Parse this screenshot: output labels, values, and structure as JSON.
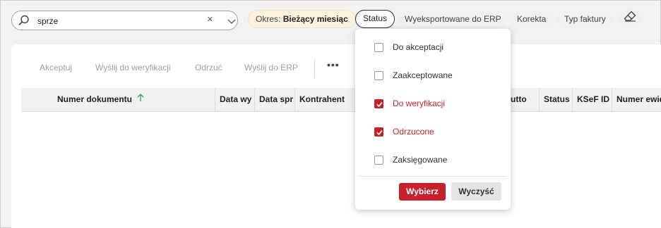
{
  "search": {
    "value": "sprze",
    "clear_glyph": "×",
    "icons": {
      "search": "search-icon",
      "clear": "close-icon",
      "dropdown": "chevron-down-icon"
    }
  },
  "filters": {
    "okres_label": "Okres:",
    "okres_value": "Bieżący miesiąc",
    "status": "Status",
    "erp": "Wyeksportowane do ERP",
    "korekta": "Korekta",
    "typ": "Typ faktury",
    "clear_icon": "eraser-icon"
  },
  "toolbar": {
    "akceptuj": "Akceptuj",
    "wyslij_weryfikacji": "Wyślij do weryfikacji",
    "odrzuc": "Odrzuć",
    "wyslij_erp": "Wyślij do ERP",
    "more": "•••"
  },
  "table": {
    "columns": [
      "Numer dokumentu",
      "Data wy",
      "Data spr",
      "Kontrahent",
      "brutto",
      "Status",
      "KSeF ID",
      "Numer ewid"
    ],
    "sort_icon": "arrow-up-icon"
  },
  "status_dropdown": {
    "options": [
      {
        "label": "Do akceptacji",
        "checked": false
      },
      {
        "label": "Zaakceptowane",
        "checked": false
      },
      {
        "label": "Do weryfikacji",
        "checked": true
      },
      {
        "label": "Odrzucone",
        "checked": true
      },
      {
        "label": "Zaksięgowane",
        "checked": false
      }
    ],
    "confirm": "Wybierz",
    "clear": "Wyczyść"
  },
  "colors": {
    "accent": "#c8202b",
    "okres_chip_bg": "#fbf1dc",
    "sort_arrow": "#3aa35a"
  }
}
